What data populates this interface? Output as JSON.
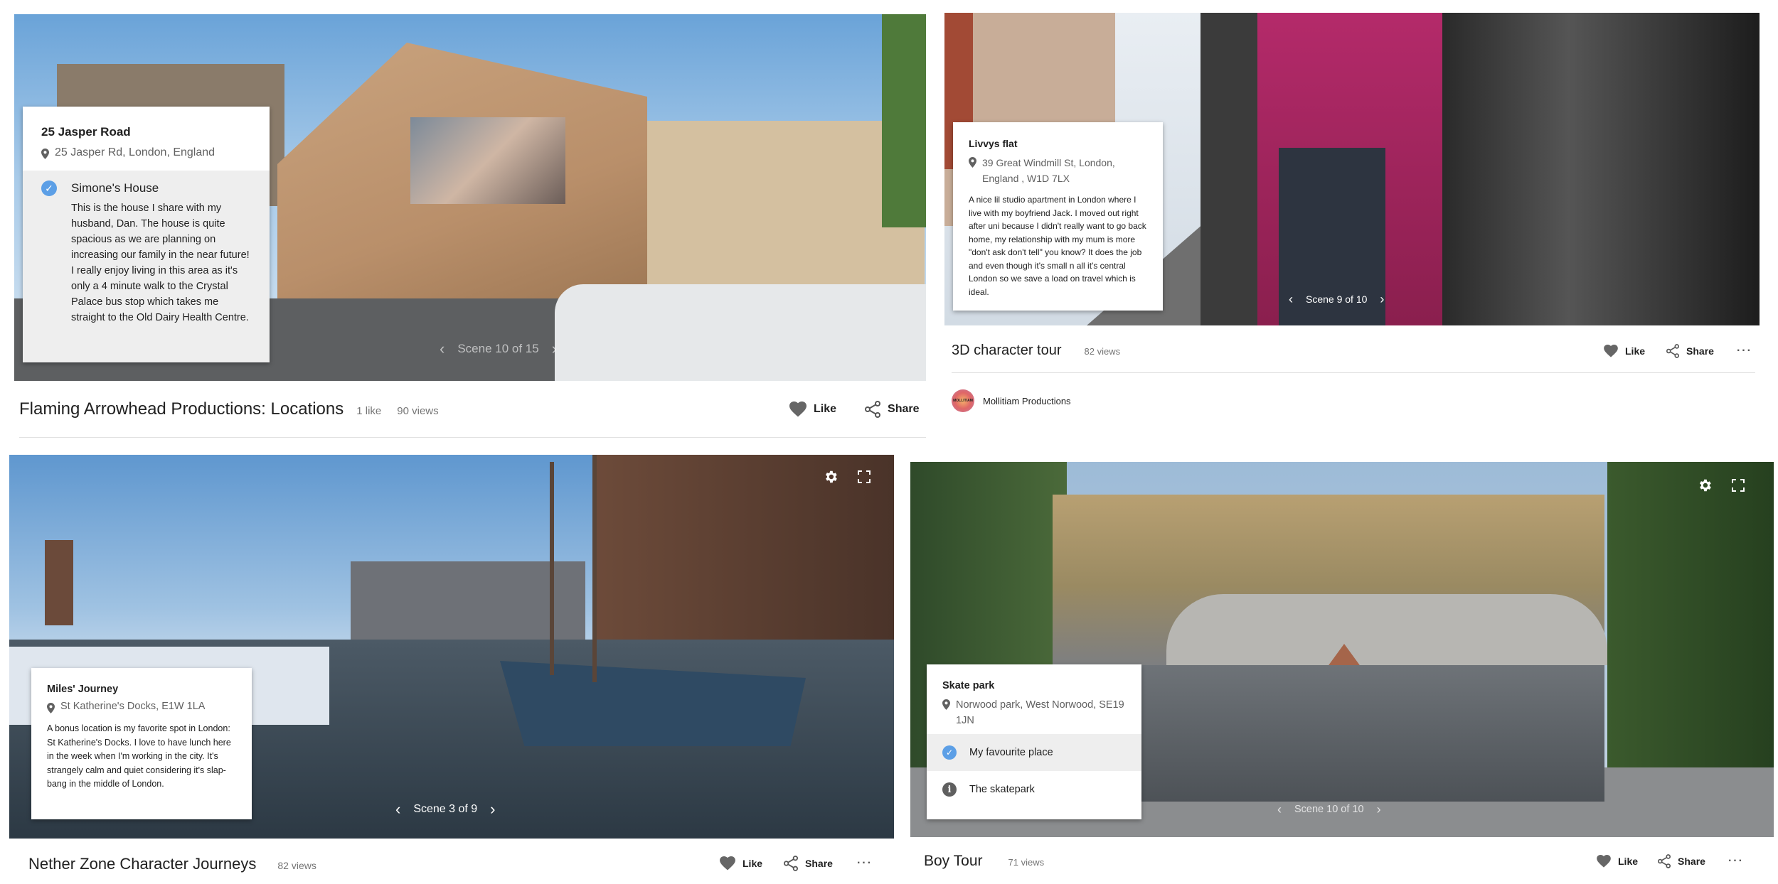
{
  "panels": {
    "top_left": {
      "card": {
        "title": "25 Jasper Road",
        "address": "25 Jasper Rd, London, England",
        "scene_name": "Simone's House",
        "scene_text": "This is the house I share with my husband, Dan. The house is quite spacious as we are planning on increasing our family in the near future! I really enjoy living in this area as it's only a 4 minute walk to the Crystal Palace bus stop which takes me straight to the Old Dairy Health Centre."
      },
      "scene_counter": "Scene 10 of 15",
      "title": "Flaming Arrowhead Productions: Locations",
      "likes": "1 like",
      "views": "90 views",
      "like_label": "Like",
      "share_label": "Share"
    },
    "top_right": {
      "card": {
        "title": "Livvys flat",
        "address": "39 Great Windmill St, London, England , W1D 7LX",
        "body": "A nice lil studio apartment in London where I live with my boyfriend Jack. I moved out right after uni because I didn't really want to go back home, my relationship with my mum is more \"don't ask don't tell\" you know? It does the job and even though it's small n all it's central London so we save a load on travel which is ideal."
      },
      "scene_counter": "Scene 9 of 10",
      "title": "3D character tour",
      "views": "82 views",
      "like_label": "Like",
      "share_label": "Share",
      "more_label": "···",
      "author": "Mollitiam Productions",
      "avatar_text": "MOLLITIAM"
    },
    "bottom_left": {
      "card": {
        "title": "Miles' Journey",
        "address": "St Katherine's Docks, E1W 1LA",
        "body": "A bonus location is my favorite spot in London: St Katherine's Docks. I love to have lunch here in the week when I'm working in the city. It's strangely calm and quiet considering it's slap-bang in the middle of London."
      },
      "scene_counter": "Scene 3 of 9",
      "title": "Nether Zone Character Journeys",
      "views": "82 views",
      "like_label": "Like",
      "share_label": "Share",
      "more_label": "···"
    },
    "bottom_right": {
      "card": {
        "title": "Skate park",
        "address": "Norwood park, West Norwood, SE19 1JN",
        "scene_1": "My favourite place",
        "scene_2": "The skatepark"
      },
      "scene_counter": "Scene 10 of 10",
      "title": "Boy Tour",
      "views": "71 views",
      "like_label": "Like",
      "share_label": "Share",
      "more_label": "···"
    }
  },
  "icons": {
    "prev": "‹",
    "next": "›",
    "check": "✓",
    "info": "i"
  }
}
